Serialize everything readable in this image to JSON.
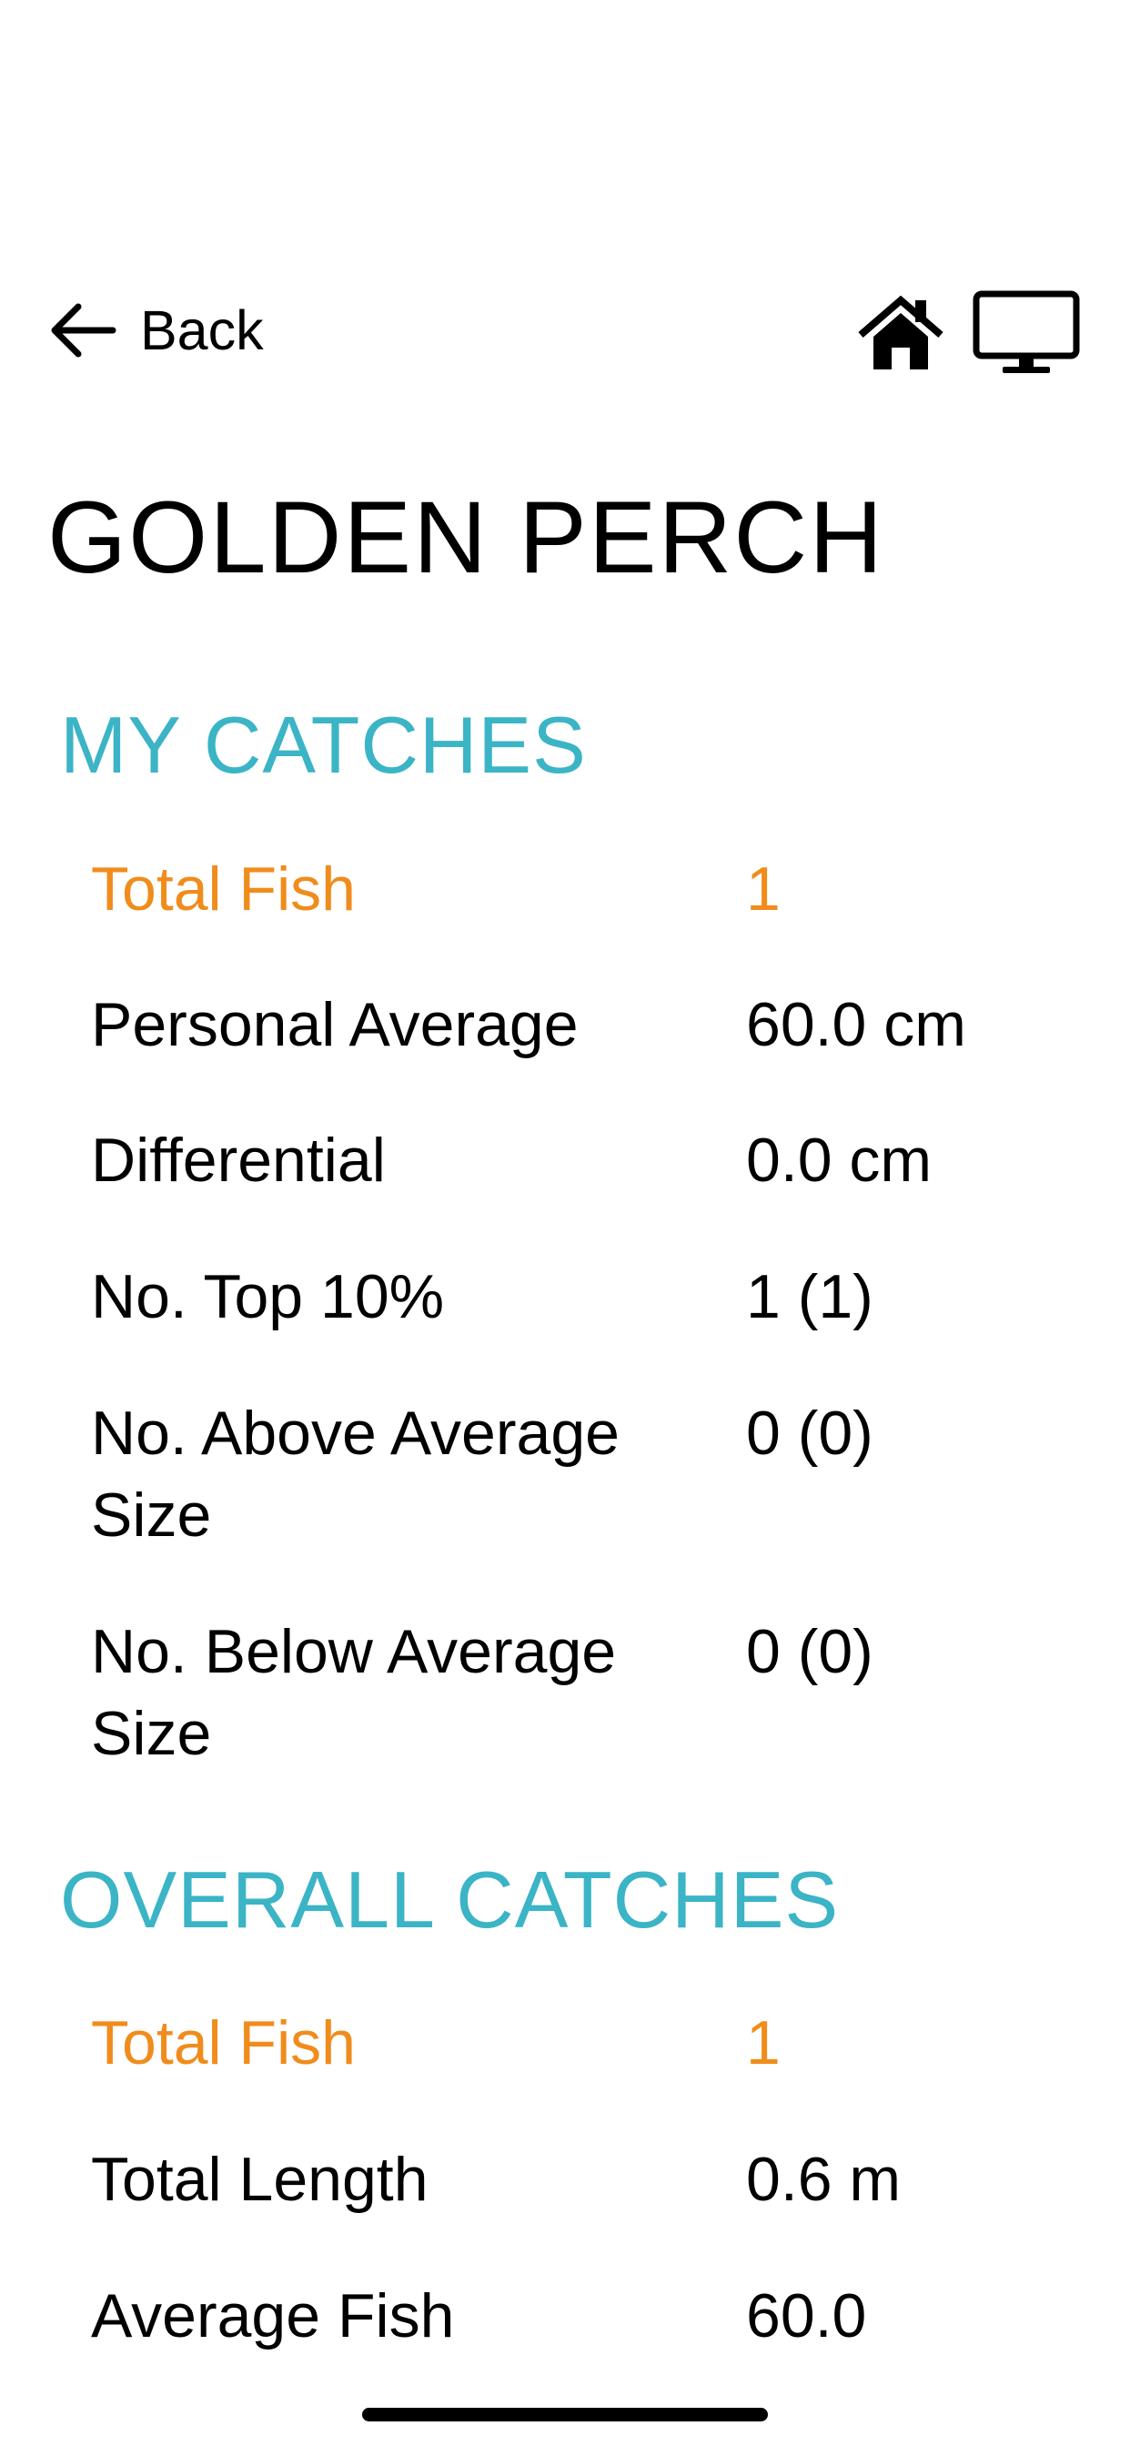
{
  "nav": {
    "back_label": "Back",
    "home_icon": "home-icon",
    "monitor_icon": "monitor-icon"
  },
  "page": {
    "title": "GOLDEN PERCH"
  },
  "my_catches": {
    "heading": "MY CATCHES",
    "rows": [
      {
        "label": "Total Fish",
        "value": "1"
      },
      {
        "label": "Personal Average",
        "value": "60.0 cm"
      },
      {
        "label": "Differential",
        "value": "0.0 cm"
      },
      {
        "label": "No. Top 10%",
        "value": "1 (1)"
      },
      {
        "label": "No. Above Average Size",
        "value": "0 (0)"
      },
      {
        "label": "No. Below Average Size",
        "value": "0 (0)"
      }
    ]
  },
  "overall_catches": {
    "heading": "OVERALL CATCHES",
    "rows": [
      {
        "label": "Total Fish",
        "value": "1"
      },
      {
        "label": "Total Length",
        "value": "0.6 m"
      },
      {
        "label": "Average Fish",
        "value": "60.0"
      }
    ]
  },
  "colors": {
    "accent_teal": "#3bb4c6",
    "highlight_orange": "#f08c1c",
    "text": "#000000",
    "background": "#ffffff"
  }
}
